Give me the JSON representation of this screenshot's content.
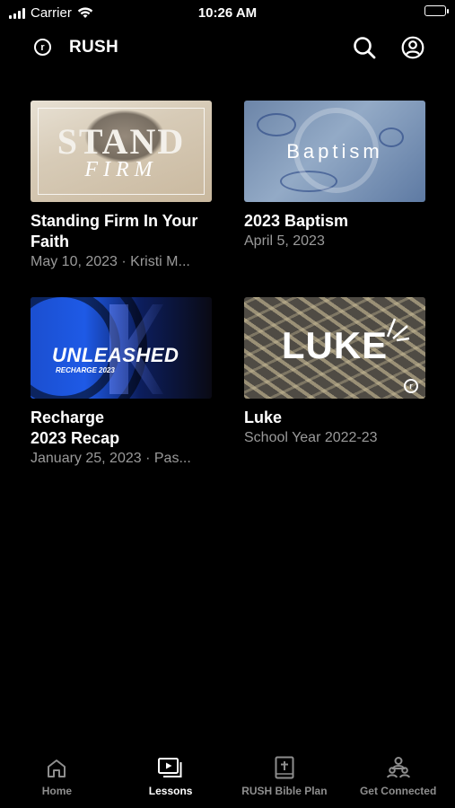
{
  "status_bar": {
    "carrier": "Carrier",
    "time": "10:26 AM"
  },
  "header": {
    "logo_letter": "r",
    "title": "RUSH"
  },
  "lessons": [
    {
      "title": "Standing Firm In Your Faith",
      "subtitle": "May 10, 2023 · Kristi M...",
      "art_text": "STAND",
      "art_text_2": "FIRM"
    },
    {
      "title": "2023 Baptism",
      "subtitle": "April 5, 2023",
      "art_text": "Baptism"
    },
    {
      "title": "Recharge 2023 Recap",
      "subtitle": "January 25, 2023 · Pas...",
      "art_text": "UNLEASHED",
      "art_text_2": "RECHARGE 2023"
    },
    {
      "title": "Luke",
      "subtitle": "School Year 2022-23",
      "art_text": "LUKE",
      "art_text_2": "r"
    }
  ],
  "tabs": [
    {
      "label": "Home",
      "icon": "home-icon",
      "active": false
    },
    {
      "label": "Lessons",
      "icon": "play-stack-icon",
      "active": true
    },
    {
      "label": "RUSH Bible Plan",
      "icon": "bible-icon",
      "active": false
    },
    {
      "label": "Get Connected",
      "icon": "people-icon",
      "active": false
    }
  ]
}
